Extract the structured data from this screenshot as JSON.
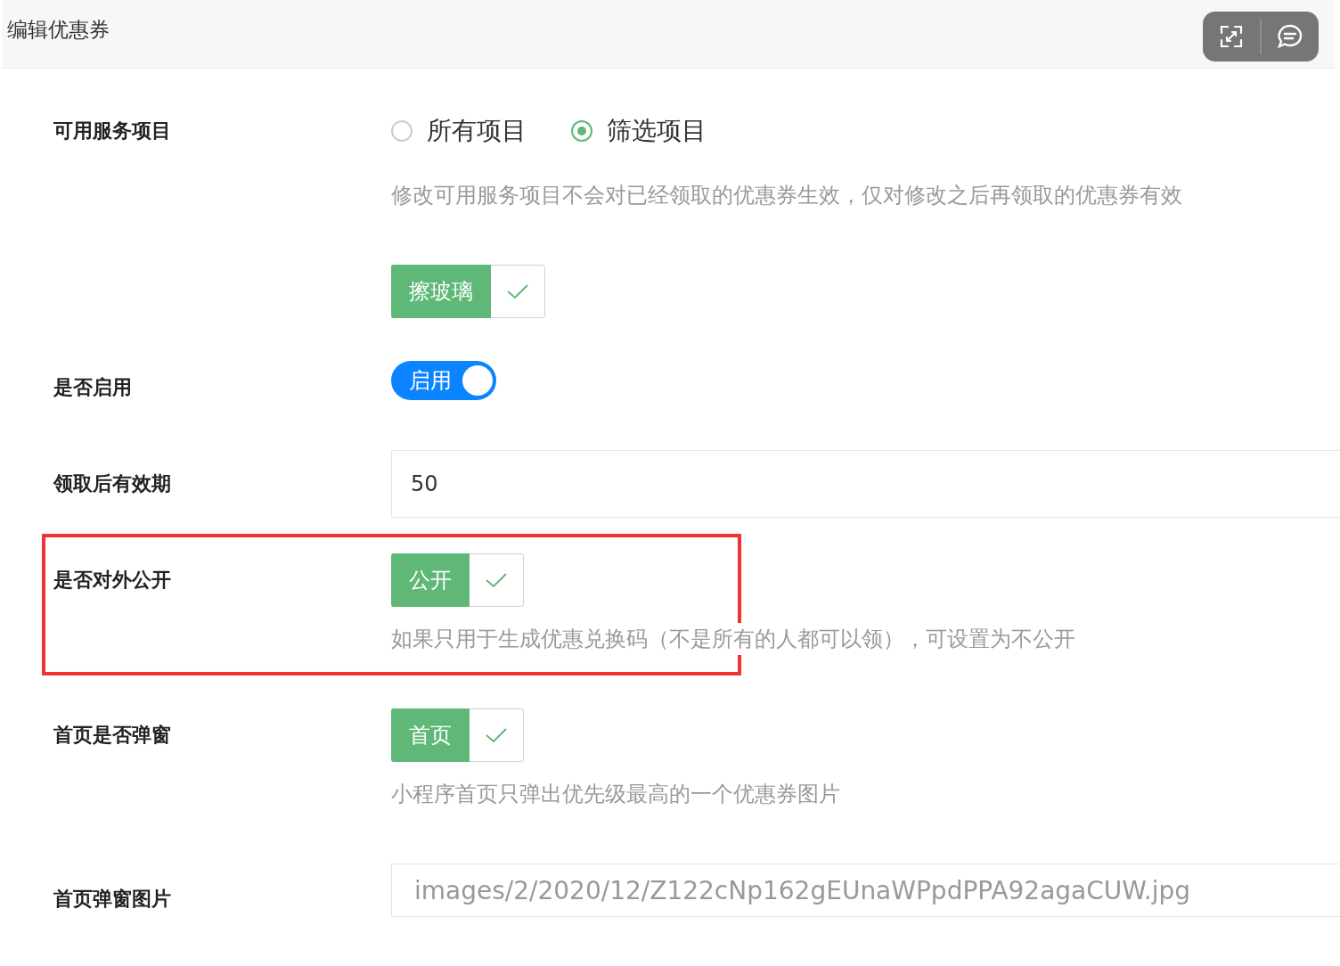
{
  "header": {
    "title": "编辑优惠券",
    "buttons": [
      {
        "kind": "fullscreen"
      },
      {
        "kind": "chat"
      }
    ]
  },
  "fields": [
    {
      "kind": "radio",
      "label": "可用服务项目",
      "options": [
        {
          "label": "所有项目",
          "selected": false
        },
        {
          "label": "筛选项目",
          "selected": true
        }
      ],
      "hint": "修改可用服务项目不会对已经领取的优惠券生效，仅对修改之后再领取的优惠券有效",
      "tags": [
        {
          "label": "擦玻璃",
          "checked": true
        }
      ]
    },
    {
      "kind": "switch",
      "label": "是否启用",
      "on": true,
      "text": "启用"
    },
    {
      "kind": "input",
      "label": "领取后有效期",
      "value": "50"
    },
    {
      "kind": "tag",
      "label": "是否对外公开",
      "tags": [
        {
          "label": "公开",
          "checked": true
        }
      ],
      "hint": "如果只用于生成优惠兑换码（不是所有的人都可以领），可设置为不公开",
      "highlighted": true
    },
    {
      "kind": "tag",
      "label": "首页是否弹窗",
      "tags": [
        {
          "label": "首页",
          "checked": true
        }
      ],
      "hint": "小程序首页只弹出优先级最高的一个优惠券图片"
    },
    {
      "kind": "input",
      "label": "首页弹窗图片",
      "value": "images/2/2020/12/Z122cNp162gEUnaWPpdPPA92agaCUW.jpg"
    }
  ]
}
